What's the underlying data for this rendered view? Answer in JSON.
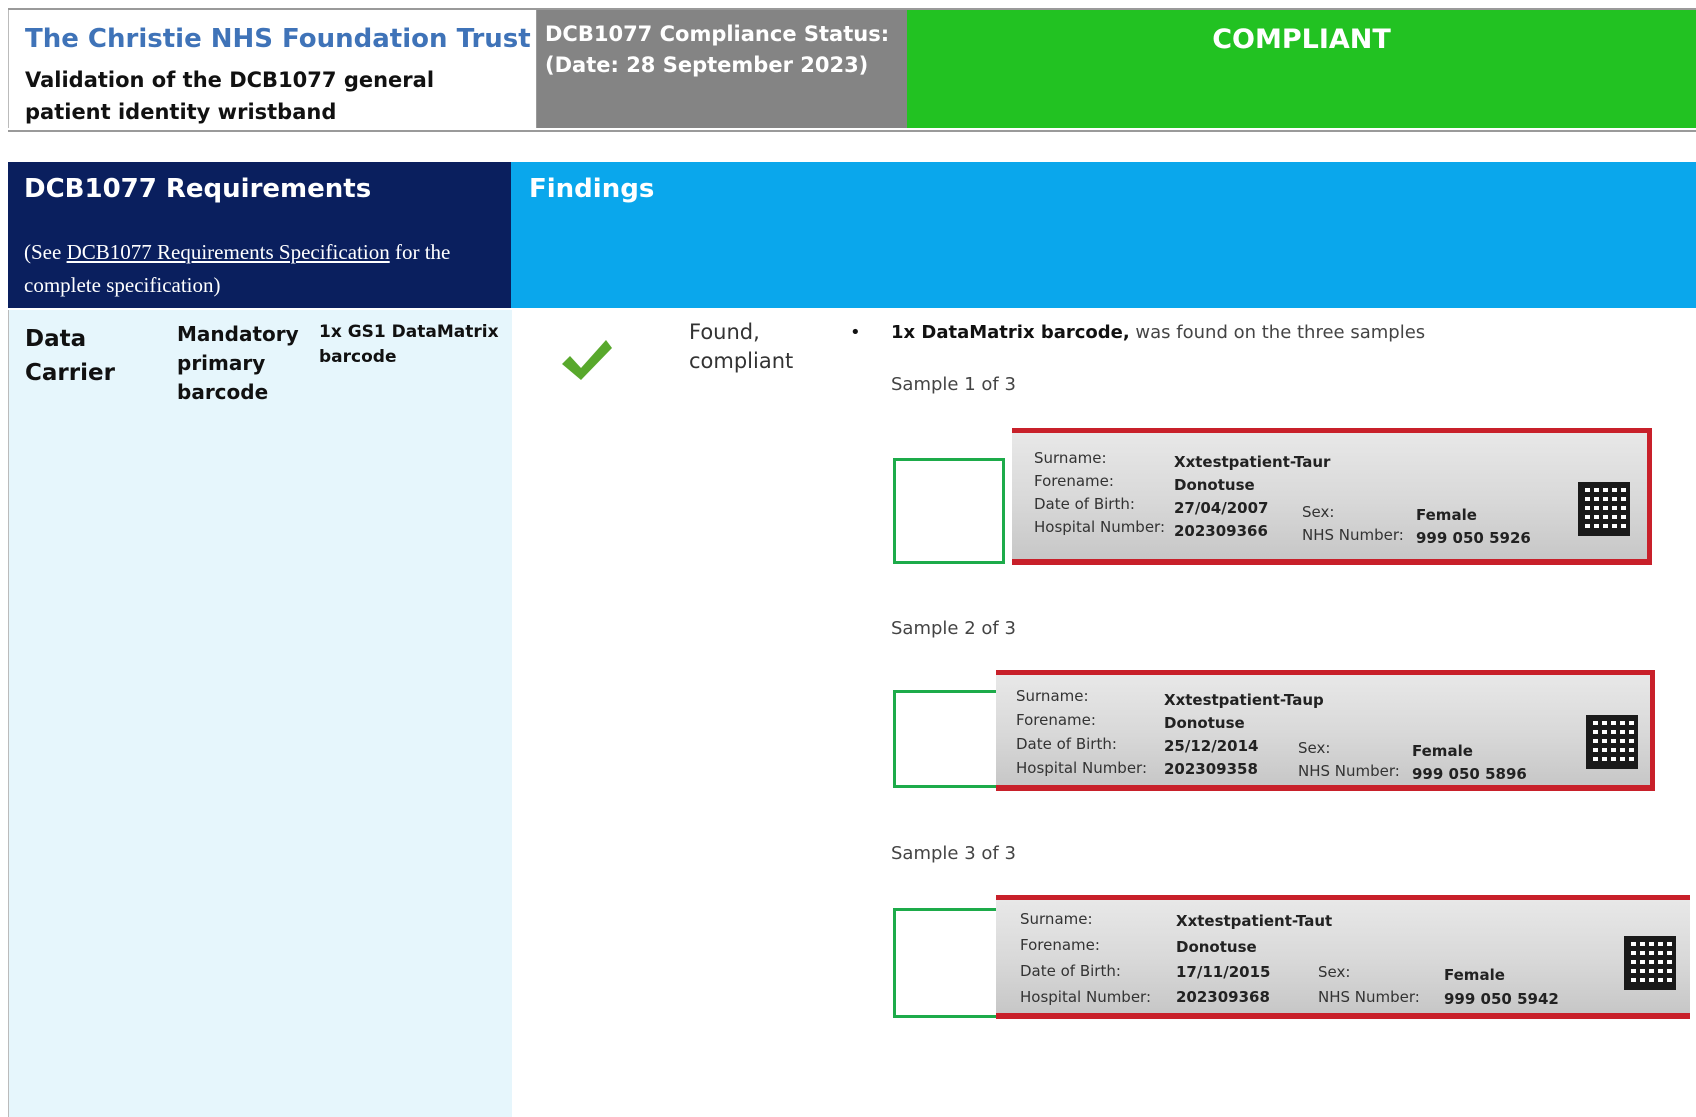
{
  "header": {
    "trust_name": "The Christie NHS Foundation Trust",
    "subtitle": "Validation of the DCB1077 general patient identity wristband",
    "status_line1": "DCB1077 Compliance Status:",
    "status_line2": "(Date: 28 September 2023)",
    "verdict": "COMPLIANT"
  },
  "requirements": {
    "title": "DCB1077 Requirements",
    "note_prefix": "(See ",
    "note_link": "DCB1077 Requirements Specification",
    "note_suffix": " for the complete specification)",
    "row": {
      "name": "Data Carrier",
      "type": "Mandatory primary barcode",
      "detail": "1x GS1 DataMatrix barcode"
    }
  },
  "findings": {
    "title": "Findings",
    "status": "Found, compliant",
    "bullet_bold": "1x DataMatrix barcode,",
    "bullet_text": " was found on the three samples",
    "samples": [
      {
        "label": "Sample 1 of 3",
        "surname_label": "Surname:",
        "surname": "Xxtestpatient-Taur",
        "forename_label": "Forename:",
        "forename": "Donotuse",
        "dob_label": "Date of Birth:",
        "dob": "27/04/2007",
        "hosp_label": "Hospital Number:",
        "hosp": "202309366",
        "sex_label": "Sex:",
        "sex": "Female",
        "nhs_label": "NHS Number:",
        "nhs": "999 050 5926"
      },
      {
        "label": "Sample 2 of 3",
        "surname_label": "Surname:",
        "surname": "Xxtestpatient-Taup",
        "forename_label": "Forename:",
        "forename": "Donotuse",
        "dob_label": "Date of Birth:",
        "dob": "25/12/2014",
        "hosp_label": "Hospital Number:",
        "hosp": "202309358",
        "sex_label": "Sex:",
        "sex": "Female",
        "nhs_label": "NHS Number:",
        "nhs": "999 050 5896"
      },
      {
        "label": "Sample 3 of 3",
        "surname_label": "Surname:",
        "surname": "Xxtestpatient-Taut",
        "forename_label": "Forename:",
        "forename": "Donotuse",
        "dob_label": "Date of Birth:",
        "dob": "17/11/2015",
        "hosp_label": "Hospital Number:",
        "hosp": "202309368",
        "sex_label": "Sex:",
        "sex": "Female",
        "nhs_label": "NHS Number:",
        "nhs": "999 050 5942"
      }
    ]
  },
  "colors": {
    "verdict_green": "#22c222",
    "requirements_navy": "#0a1f5e",
    "findings_blue": "#0aa7ec",
    "trust_blue": "#3f73b8",
    "check_green": "#58a82c",
    "wristband_red": "#c8202a"
  },
  "icons": {
    "check": "check-icon",
    "barcode": "datamatrix-barcode-icon"
  }
}
